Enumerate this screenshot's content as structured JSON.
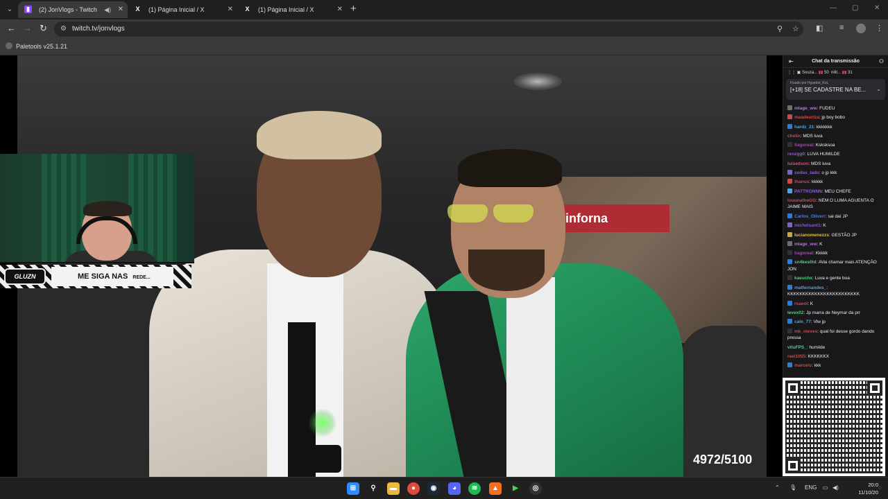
{
  "browser": {
    "tabs": [
      {
        "title": "(2) JonVlogs - Twitch",
        "favicon": "twitch-icon",
        "active": true
      },
      {
        "title": "(1) Página Inicial / X",
        "favicon": "x-icon",
        "active": false
      },
      {
        "title": "(1) Página Inicial / X",
        "favicon": "x-icon",
        "active": false
      }
    ],
    "url": "twitch.tv/jonvlogs",
    "bookmark": "Paletools v25.1.21"
  },
  "video": {
    "counter": "4972/5100",
    "sign_text": "inforna",
    "banner_logo": "GLUZN",
    "banner_text": "ME SIGA NAS",
    "banner_text_tail": "REDE..."
  },
  "chat": {
    "title": "Chat da transmissão",
    "gifts": [
      {
        "user": "Souza...",
        "count": "50"
      },
      {
        "user": "nilit...",
        "count": "31"
      }
    ],
    "pinned_by": "Fixado por Hypebot_KoL",
    "pinned_text": "[+18] SE CADASTRE NA BE...",
    "messages": [
      {
        "user": "mlage_ww",
        "text": "FUDEU",
        "color": "#b96ee8",
        "badge": "#6f6f6f"
      },
      {
        "user": "maadeuriza",
        "text": "jp boy bobo",
        "color": "#d04848",
        "badge": "#d04848"
      },
      {
        "user": "hardz_21",
        "text": "kkkkkkk",
        "color": "#4fa3e0",
        "badge": "#2a7fd4"
      },
      {
        "user": "chelin",
        "text": "MDS luva",
        "color": "#d04848",
        "badge": ""
      },
      {
        "user": "tiagoreal",
        "text": "Ksksksoa",
        "color": "#b13fb8",
        "badge": "#333"
      },
      {
        "user": "renzgg0",
        "text": "LUVA HUMILDE",
        "color": "#8f58d9",
        "badge": ""
      },
      {
        "user": "luisedson",
        "text": "MDS luva",
        "color": "#d84f7a",
        "badge": ""
      },
      {
        "user": "sodas_lado",
        "text": "o jp kkk",
        "color": "#8f58d9",
        "badge": "#7b61d4"
      },
      {
        "user": "thanus",
        "text": "kkkkk",
        "color": "#d04848",
        "badge": "#d04848"
      },
      {
        "user": "PATTRONNN",
        "text": "MEU CHEFE",
        "color": "#8f58d9",
        "badge": "#4fa3e0"
      },
      {
        "user": "luuunatheGG",
        "text": "NEM O LUMA AGUENTA O JAIME MAIS",
        "color": "#d04848",
        "badge": "",
        "wrap": true
      },
      {
        "user": "Carlos_Oliverr",
        "text": "sai daí JP",
        "color": "#4f7de0",
        "badge": "#2a7fd4"
      },
      {
        "user": "michelsant1",
        "text": "K",
        "color": "#8f58d9",
        "badge": "#7b61d4"
      },
      {
        "user": "lucianomenezzs",
        "text": "GESTÃO JP",
        "color": "#e0c04f",
        "badge": "#c9a93a"
      },
      {
        "user": "mlage_ww",
        "text": "K",
        "color": "#b96ee8",
        "badge": "#6f6f6f"
      },
      {
        "user": "tiagoreal",
        "text": "Kkkkk",
        "color": "#b13fb8",
        "badge": "#333"
      },
      {
        "user": "sn4kes0ld",
        "text": "AVai chamar mais ATENÇÃO JON",
        "color": "#4fd07a",
        "badge": "#2a7fd4",
        "wrap": true
      },
      {
        "user": "kaeuchx",
        "text": "Luva e gente boa",
        "color": "#4fd07a",
        "badge": "#333"
      },
      {
        "user": "matfernandes_",
        "text": "KKKKKKKKKKKKKKKKKKKKKKKK",
        "color": "#4fa3e0",
        "badge": "#2a7fd4",
        "wrap": true
      },
      {
        "user": "rsaeol",
        "text": "K",
        "color": "#d04848",
        "badge": "#2a7fd4"
      },
      {
        "user": "levex02",
        "text": "Jp marra de Neymar da prr",
        "color": "#4fd07a",
        "badge": ""
      },
      {
        "user": "calo_77",
        "text": "Vlw jp",
        "color": "#4fa3e0",
        "badge": "#2a7fd4"
      },
      {
        "user": "mk_nieves",
        "text": "qual foi desse gordo dando pressa",
        "color": "#d04848",
        "badge": "#333",
        "wrap": true
      },
      {
        "user": "vituFPS_",
        "text": "humilde",
        "color": "#4fd07a",
        "badge": ""
      },
      {
        "user": "raei1055",
        "text": "KKKKKKX",
        "color": "#d04848",
        "badge": ""
      },
      {
        "user": "marcelo",
        "text": "kkk",
        "color": "#d04848",
        "badge": "#2a7fd4"
      }
    ]
  },
  "taskbar": {
    "lang": "ENG",
    "time": "20:0",
    "date": "11/10/20"
  }
}
